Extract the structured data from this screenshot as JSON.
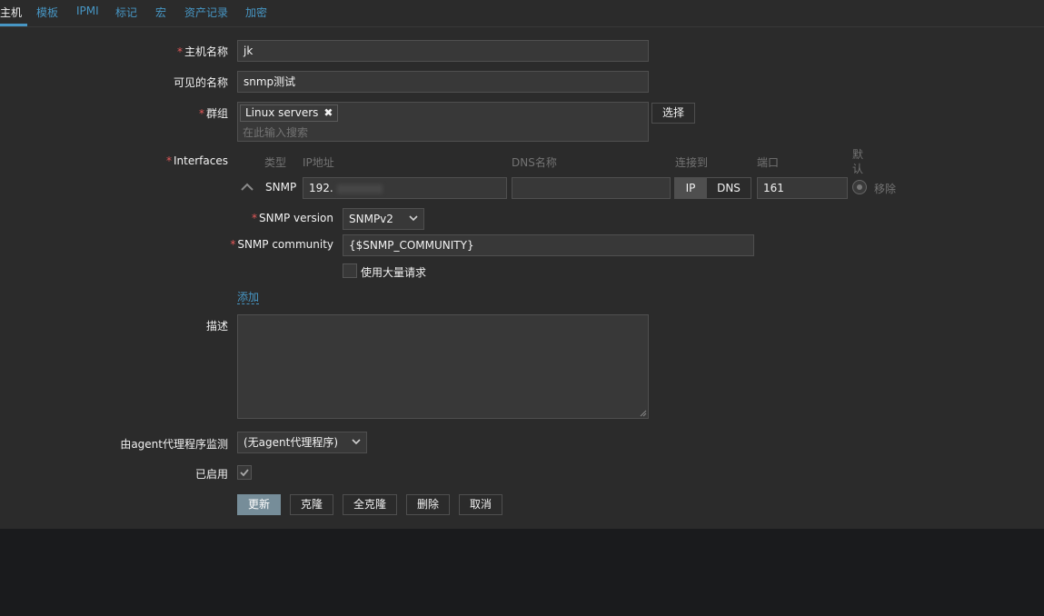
{
  "tabs": [
    {
      "label": "主机"
    },
    {
      "label": "模板"
    },
    {
      "label": "IPMI"
    },
    {
      "label": "标记"
    },
    {
      "label": "宏"
    },
    {
      "label": "资产记录"
    },
    {
      "label": "加密"
    }
  ],
  "form": {
    "required_mark": "*",
    "host_name": {
      "label": "主机名称",
      "value": "jk"
    },
    "visible_name": {
      "label": "可见的名称",
      "value": "snmp测试"
    },
    "groups": {
      "label": "群组",
      "chip": "Linux servers",
      "chip_remove": "✖",
      "placeholder": "在此输入搜索",
      "select_button": "选择"
    },
    "interfaces": {
      "label": "Interfaces",
      "headers": {
        "type": "类型",
        "ip": "IP地址",
        "dns": "DNS名称",
        "connect": "连接到",
        "port": "端口",
        "default": "默认"
      },
      "row": {
        "type": "SNMP",
        "ip": "192.",
        "dns": "",
        "connect_ip": "IP",
        "connect_dns": "DNS",
        "port": "161",
        "remove": "移除"
      },
      "snmp_version": {
        "label": "SNMP version",
        "value": "SNMPv2"
      },
      "snmp_community": {
        "label": "SNMP community",
        "value": "{$SNMP_COMMUNITY}"
      },
      "bulk": {
        "label": "使用大量请求"
      },
      "add_link": "添加"
    },
    "description": {
      "label": "描述"
    },
    "proxy": {
      "label": "由agent代理程序监测",
      "value": "(无agent代理程序)"
    },
    "enabled": {
      "label": "已启用",
      "checked": true
    }
  },
  "actions": {
    "update": "更新",
    "clone": "克隆",
    "full_clone": "全克隆",
    "delete": "删除",
    "cancel": "取消"
  },
  "colors": {
    "accent": "#4796c4",
    "required": "#e45959",
    "primary_button": "#768d99"
  }
}
